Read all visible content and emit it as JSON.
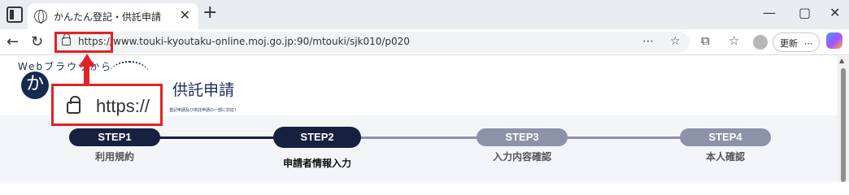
{
  "browser": {
    "tab": {
      "title": "かんたん登記・供託申請",
      "close": "✕"
    },
    "new_tab": "+",
    "window_controls": [
      "—",
      "▢",
      "✕"
    ],
    "nav": {
      "back": "←",
      "reload": "↻"
    },
    "url": "https://www.touki-kyoutaku-online.moj.go.jp:90/mtouki/sjk010/p020",
    "url_icons": [
      "⋯",
      "☆"
    ],
    "toolbar_icons": [
      "⧉",
      "☆"
    ],
    "update_button": "更新",
    "more": "⋯"
  },
  "site": {
    "logo_tagline": "Webブラウザから",
    "logo_glyph": "か",
    "name": "供託申請",
    "subtitle": "登記申請及び供託申請の一部に対応！"
  },
  "steps": [
    {
      "step": "STEP1",
      "label": "利用規約",
      "status": "done",
      "color": "#16203f"
    },
    {
      "step": "STEP2",
      "label": "申請者情報入力",
      "status": "current",
      "color": "#16203f"
    },
    {
      "step": "STEP3",
      "label": "入力内容確認",
      "status": "todo",
      "color": "#8c93a8"
    },
    {
      "step": "STEP4",
      "label": "本人確認",
      "status": "todo",
      "color": "#8c93a8"
    }
  ],
  "callout": {
    "text": "https://",
    "highlight_color": "#e22227"
  }
}
